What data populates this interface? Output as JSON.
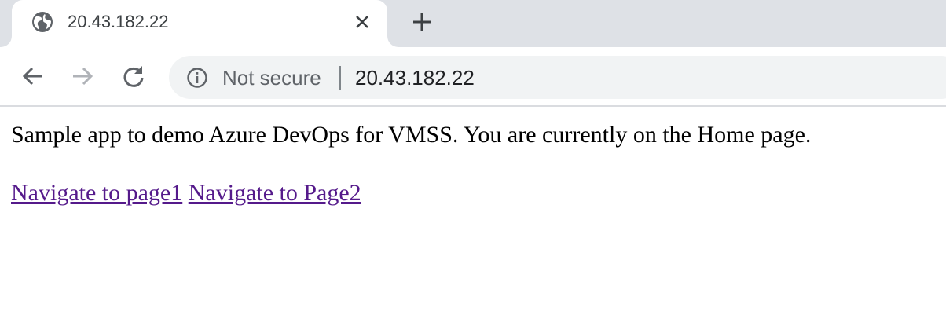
{
  "tab": {
    "title": "20.43.182.22",
    "favicon": "globe-icon",
    "close_icon": "close-icon"
  },
  "new_tab_icon": "plus-icon",
  "toolbar": {
    "back_icon": "back-arrow-icon",
    "forward_icon": "forward-arrow-icon",
    "reload_icon": "reload-icon"
  },
  "omnibox": {
    "security_icon": "info-icon",
    "security_label": "Not secure",
    "url": "20.43.182.22"
  },
  "page": {
    "text": "Sample app to demo Azure DevOps for VMSS. You are currently on the Home page.",
    "links": [
      {
        "label": "Navigate to page1"
      },
      {
        "label": "Navigate to Page2"
      }
    ]
  },
  "colors": {
    "tab_strip": "#dee1e6",
    "omnibox_bg": "#f1f3f4",
    "visited_link": "#551a8b"
  }
}
